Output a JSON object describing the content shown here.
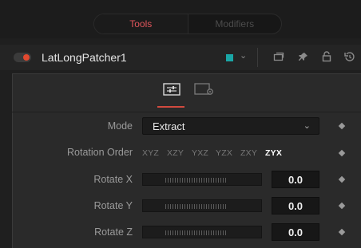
{
  "top_tabs": [
    {
      "label": "Tools",
      "active": true
    },
    {
      "label": "Modifiers",
      "active": false
    }
  ],
  "node": {
    "name": "LatLongPatcher1",
    "color": "#1aa6a6"
  },
  "header_icons": [
    "window-icon",
    "pin-icon",
    "lock-icon",
    "reset-icon"
  ],
  "panel_tabs": [
    {
      "icon": "sliders-icon",
      "active": true
    },
    {
      "icon": "gear-settings-icon",
      "active": false
    }
  ],
  "controls": {
    "mode": {
      "label": "Mode",
      "value": "Extract"
    },
    "rotation_order": {
      "label": "Rotation Order",
      "options": [
        "XYZ",
        "XZY",
        "YXZ",
        "YZX",
        "ZXY",
        "ZYX"
      ],
      "selected": "ZYX"
    },
    "rotate_x": {
      "label": "Rotate X",
      "value": "0.0"
    },
    "rotate_y": {
      "label": "Rotate Y",
      "value": "0.0"
    },
    "rotate_z": {
      "label": "Rotate Z",
      "value": "0.0"
    }
  },
  "colors": {
    "accent_red": "#e0555b",
    "record_red": "#e2492f",
    "tab_underline": "#d24a3e"
  }
}
